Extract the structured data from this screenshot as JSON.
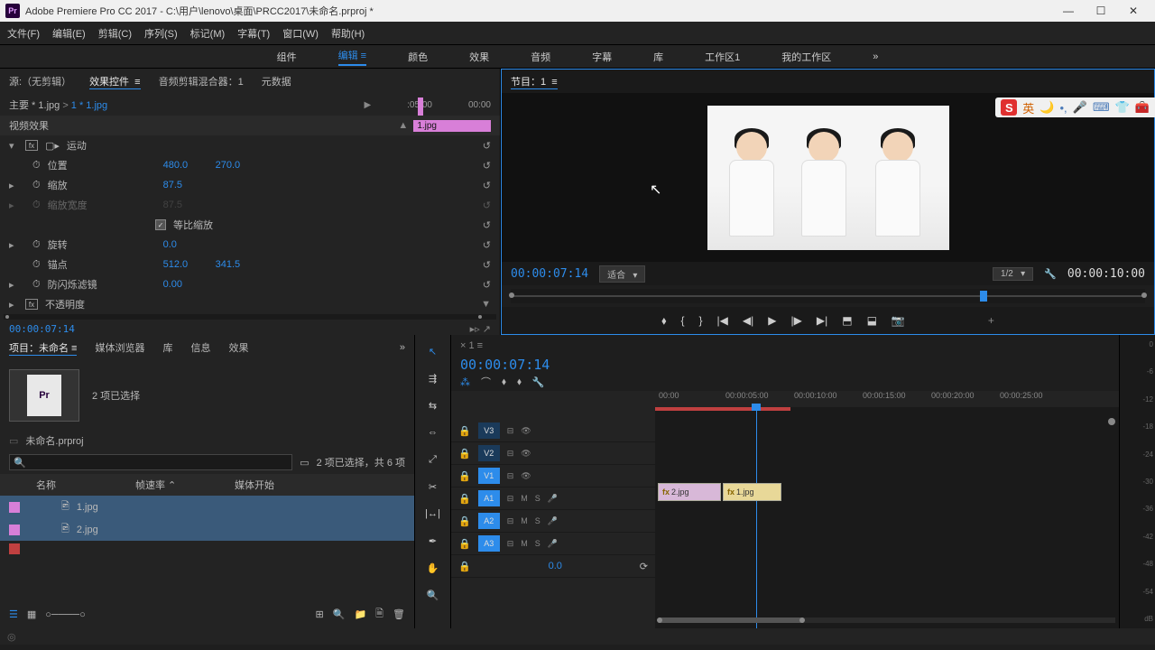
{
  "title": "Adobe Premiere Pro CC 2017 - C:\\用户\\lenovo\\桌面\\PRCC2017\\未命名.prproj *",
  "menus": [
    "文件(F)",
    "编辑(E)",
    "剪辑(C)",
    "序列(S)",
    "标记(M)",
    "字幕(T)",
    "窗口(W)",
    "帮助(H)"
  ],
  "workspaces": [
    "组件",
    "编辑",
    "颜色",
    "效果",
    "音频",
    "字幕",
    "库",
    "工作区1",
    "我的工作区"
  ],
  "ws_active": "编辑",
  "source_tabs": {
    "a": "源:（无剪辑）",
    "b": "效果控件",
    "c": "音频剪辑混合器：1",
    "d": "元数据"
  },
  "fx": {
    "master": "主要 * 1.jpg",
    "instance": "1 * 1.jpg",
    "tc_a": ":05:00",
    "tc_b": "00:00",
    "clip": "1.jpg",
    "section_video": "视频效果",
    "motion": "运动",
    "pos": "位置",
    "pos_x": "480.0",
    "pos_y": "270.0",
    "scale": "缩放",
    "scale_v": "87.5",
    "scale_w": "缩放宽度",
    "scale_w_v": "87.5",
    "uniform": "等比缩放",
    "rotation": "旋转",
    "rotation_v": "0.0",
    "anchor": "锚点",
    "anchor_x": "512.0",
    "anchor_y": "341.5",
    "flicker": "防闪烁滤镜",
    "flicker_v": "0.00",
    "opacity": "不透明度",
    "timecode": "00:00:07:14"
  },
  "program": {
    "title": "节目：1",
    "tc": "00:00:07:14",
    "fit": "适合",
    "zoom": "1/2",
    "dur": "00:00:10:00"
  },
  "project": {
    "tabs": {
      "a": "项目：未命名",
      "b": "媒体浏览器",
      "c": "库",
      "d": "信息",
      "e": "效果"
    },
    "sel_text": "2 项已选择",
    "bin": "未命名.prproj",
    "status": "2 项已选择，共 6 项",
    "cols": {
      "name": "名称",
      "rate": "帧速率",
      "start": "媒体开始"
    },
    "items": [
      "1.jpg",
      "2.jpg"
    ]
  },
  "timeline": {
    "seq": "1",
    "tc": "00:00:07:14",
    "marks": [
      "00:00",
      "00:00:05:00",
      "00:00:10:00",
      "00:00:15:00",
      "00:00:20:00",
      "00:00:25:00"
    ],
    "v_tracks": [
      "V3",
      "V2",
      "V1"
    ],
    "a_tracks": [
      "A1",
      "A2",
      "A3"
    ],
    "clips": {
      "a": "2.jpg",
      "b": "1.jpg"
    },
    "master": "0.0"
  },
  "meters": [
    "0",
    "-6",
    "-12",
    "-18",
    "-24",
    "-30",
    "-36",
    "-42",
    "-48",
    "-54",
    "dB"
  ],
  "ime": "英"
}
